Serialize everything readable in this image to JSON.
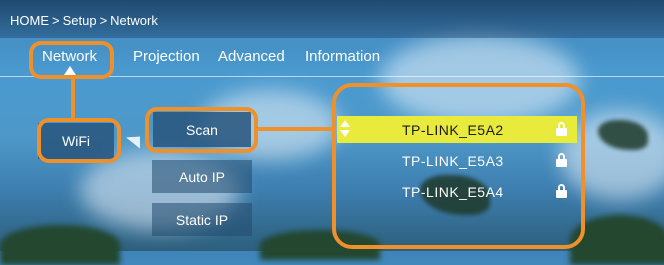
{
  "breadcrumb": {
    "home": "HOME",
    "setup": "Setup",
    "network": "Network",
    "separator": ">"
  },
  "tabs": [
    {
      "label": "Network",
      "active": true
    },
    {
      "label": "Projection",
      "active": false
    },
    {
      "label": "Advanced",
      "active": false
    },
    {
      "label": "Information",
      "active": false
    }
  ],
  "left_menu": {
    "wifi_label": "WiFi"
  },
  "options": {
    "scan_label": "Scan",
    "auto_ip_label": "Auto IP",
    "static_ip_label": "Static IP"
  },
  "networks": [
    {
      "ssid": "TP-LINK_E5A2",
      "secured": true,
      "highlighted": true
    },
    {
      "ssid": "TP-LINK_E5A3",
      "secured": true,
      "highlighted": false
    },
    {
      "ssid": "TP-LINK_E5A4",
      "secured": true,
      "highlighted": false
    }
  ],
  "icons": {
    "lock": "lock-icon",
    "updown": "updown-arrows-icon",
    "caret": "tab-caret-icon",
    "arrow": "arrow-right-icon"
  },
  "colors": {
    "highlight_ring": "#f0902a",
    "selected_row": "#e8ea3c",
    "button_bg": "#234b6e"
  }
}
